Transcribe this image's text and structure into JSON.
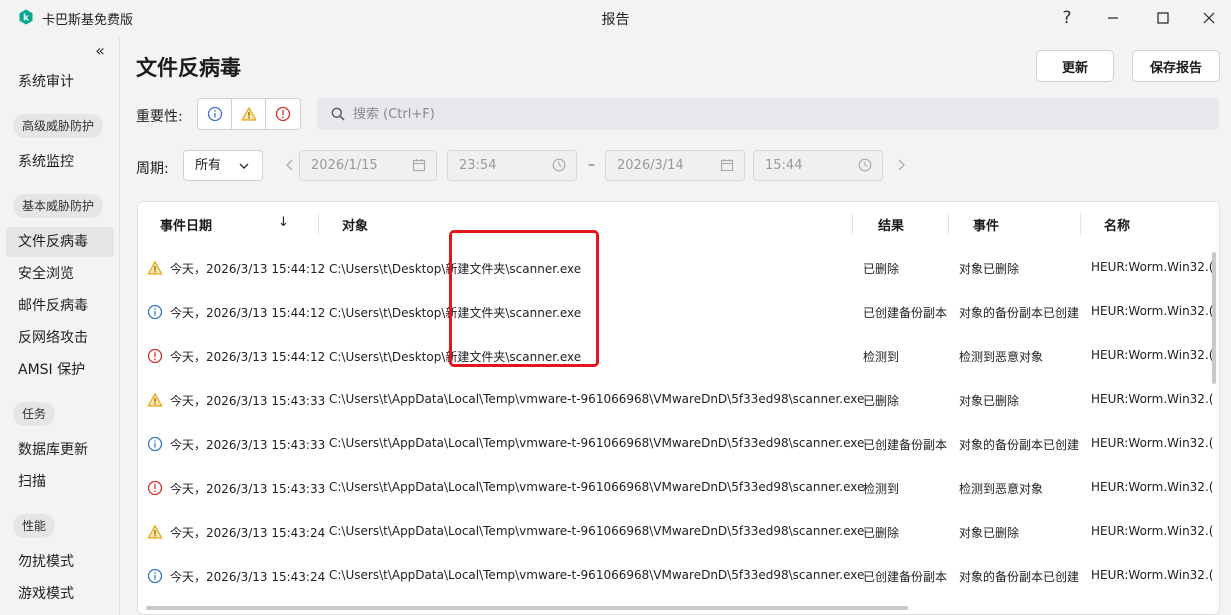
{
  "app": {
    "name": "卡巴斯基免费版",
    "window_title": "报告",
    "brand_color": "#00a88e"
  },
  "window_controls": {
    "help": "?",
    "minimize": "minimize-icon",
    "maximize": "maximize-icon",
    "close": "close-icon"
  },
  "sidebar": {
    "collapse_icon": "«",
    "items": [
      {
        "type": "item",
        "label": "系统审计"
      },
      {
        "type": "group",
        "label": "高级威胁防护"
      },
      {
        "type": "item",
        "label": "系统监控"
      },
      {
        "type": "group",
        "label": "基本威胁防护"
      },
      {
        "type": "item",
        "label": "文件反病毒",
        "active": true
      },
      {
        "type": "item",
        "label": "安全浏览"
      },
      {
        "type": "item",
        "label": "邮件反病毒"
      },
      {
        "type": "item",
        "label": "反网络攻击"
      },
      {
        "type": "item",
        "label": "AMSI 保护"
      },
      {
        "type": "group",
        "label": "任务"
      },
      {
        "type": "item",
        "label": "数据库更新"
      },
      {
        "type": "item",
        "label": "扫描"
      },
      {
        "type": "group",
        "label": "性能"
      },
      {
        "type": "item",
        "label": "勿扰模式"
      },
      {
        "type": "item",
        "label": "游戏模式"
      }
    ]
  },
  "main": {
    "title": "文件反病毒",
    "update_button": "更新",
    "save_report_button": "保存报告",
    "severity_label": "重要性:",
    "search_placeholder": "搜索 (Ctrl+F)",
    "period_label": "周期:",
    "period_value": "所有",
    "date_from": "2026/1/15",
    "time_from": "23:54",
    "dash": "–",
    "date_to": "2026/3/14",
    "time_to": "15:44"
  },
  "table": {
    "columns": {
      "date": "事件日期",
      "sort": "↓",
      "object": "对象",
      "result": "结果",
      "event": "事件",
      "name": "名称"
    },
    "rows": [
      {
        "severity": "warning",
        "date": "今天，2026/3/13 15:44:12",
        "object": "C:\\Users\\t\\Desktop\\新建文件夹\\scanner.exe",
        "result": "已删除",
        "event": "对象已删除",
        "name": "HEUR:Worm.Win32.("
      },
      {
        "severity": "info",
        "date": "今天，2026/3/13 15:44:12",
        "object": "C:\\Users\\t\\Desktop\\新建文件夹\\scanner.exe",
        "result": "已创建备份副本",
        "event": "对象的备份副本已创建",
        "name": "HEUR:Worm.Win32.("
      },
      {
        "severity": "critical",
        "date": "今天，2026/3/13 15:44:12",
        "object": "C:\\Users\\t\\Desktop\\新建文件夹\\scanner.exe",
        "result": "检测到",
        "event": "检测到恶意对象",
        "name": "HEUR:Worm.Win32.("
      },
      {
        "severity": "warning",
        "date": "今天，2026/3/13 15:43:33",
        "object": "C:\\Users\\t\\AppData\\Local\\Temp\\vmware-t-961066968\\VMwareDnD\\5f33ed98\\scanner.exe",
        "result": "已删除",
        "event": "对象已删除",
        "name": "HEUR:Worm.Win32.("
      },
      {
        "severity": "info",
        "date": "今天，2026/3/13 15:43:33",
        "object": "C:\\Users\\t\\AppData\\Local\\Temp\\vmware-t-961066968\\VMwareDnD\\5f33ed98\\scanner.exe",
        "result": "已创建备份副本",
        "event": "对象的备份副本已创建",
        "name": "HEUR:Worm.Win32.("
      },
      {
        "severity": "critical",
        "date": "今天，2026/3/13 15:43:33",
        "object": "C:\\Users\\t\\AppData\\Local\\Temp\\vmware-t-961066968\\VMwareDnD\\5f33ed98\\scanner.exe",
        "result": "检测到",
        "event": "检测到恶意对象",
        "name": "HEUR:Worm.Win32.("
      },
      {
        "severity": "warning",
        "date": "今天，2026/3/13 15:43:24",
        "object": "C:\\Users\\t\\AppData\\Local\\Temp\\vmware-t-961066968\\VMwareDnD\\5f33ed98\\scanner.exe",
        "result": "已删除",
        "event": "对象已删除",
        "name": "HEUR:Worm.Win32.("
      },
      {
        "severity": "info",
        "date": "今天，2026/3/13 15:43:24",
        "object": "C:\\Users\\t\\AppData\\Local\\Temp\\vmware-t-961066968\\VMwareDnD\\5f33ed98\\scanner.exe",
        "result": "已创建备份副本",
        "event": "对象的备份副本已创建",
        "name": "HEUR:Worm.Win32.("
      }
    ]
  },
  "colors": {
    "info": "#3b73c9",
    "warning": "#e8a317",
    "critical": "#d92b2b",
    "highlight": "#e3161b"
  }
}
